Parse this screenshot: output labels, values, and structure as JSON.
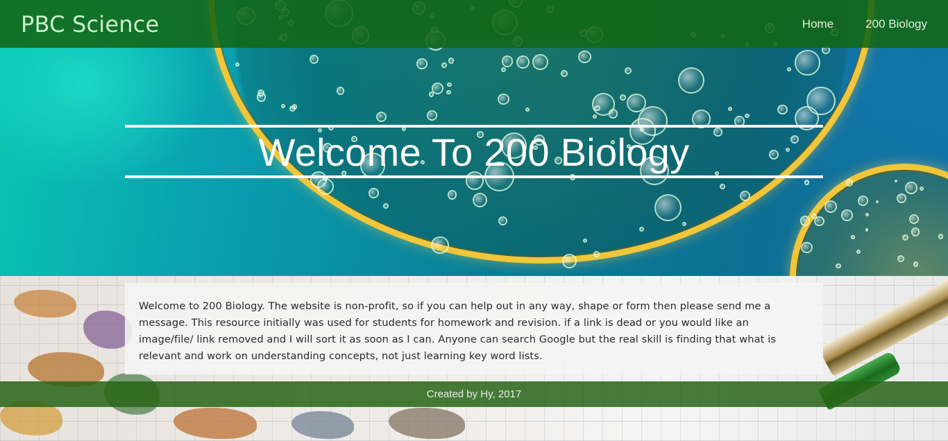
{
  "navbar": {
    "brand": "PBC Science",
    "links": [
      {
        "label": "Home"
      },
      {
        "label": "200 Biology"
      }
    ]
  },
  "hero": {
    "title": "Welcome To 200 Biology"
  },
  "info": {
    "text": "Welcome to 200 Biology. The website is non-profit, so if you can help out in any way, shape or form then please send me a message. This resource initially was used for students for homework and revision. if a link is dead or you would like an image/file/ link removed and I will sort it as soon as I can. Anyone can search Google but the real skill is finding that what is relevant and work on understanding concepts, not just learning key word lists."
  },
  "footer": {
    "credit": "Created by Hy, 2017"
  },
  "colors": {
    "navbar": "#126614",
    "brand_text": "#c9f0cc",
    "footer": "#286416",
    "dish_rim": "#f0c63a"
  }
}
